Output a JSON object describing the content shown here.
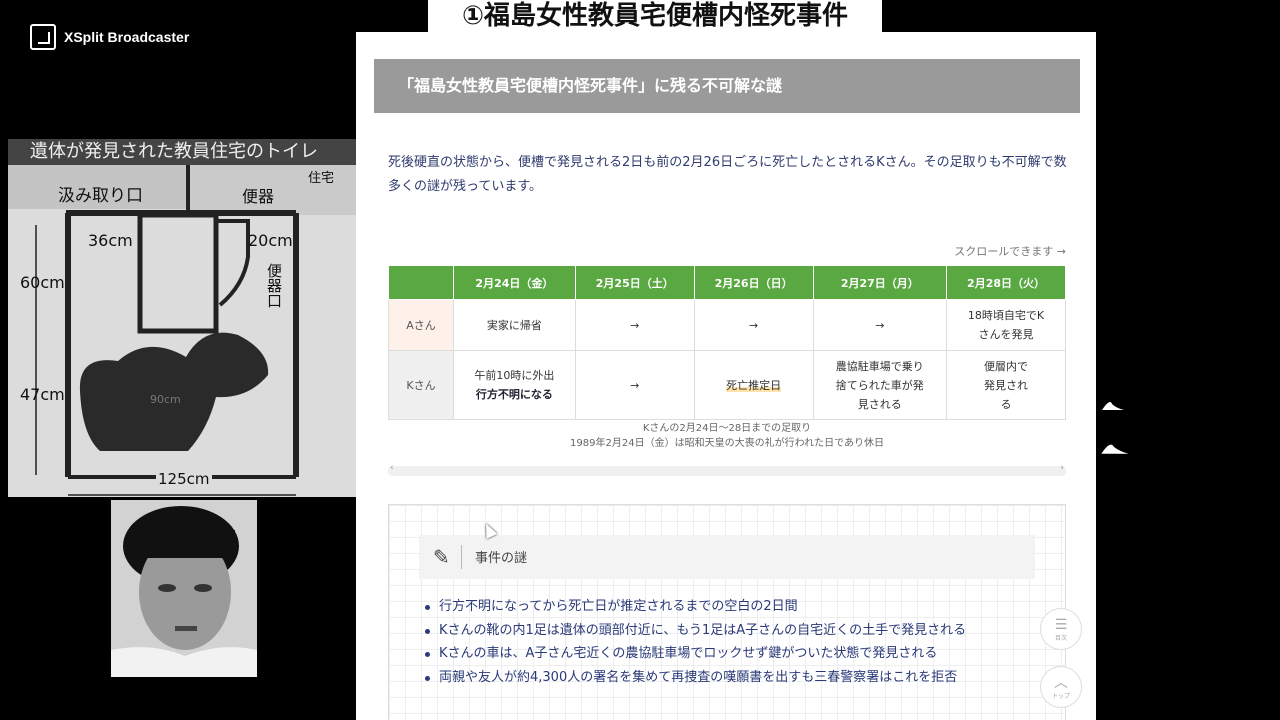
{
  "broadcast": {
    "title": "①福島女性教員宅便槽内怪死事件",
    "app_name": "XSplit Broadcaster"
  },
  "floorplan": {
    "caption": "遺体が発見された教員住宅のトイレ",
    "labels": {
      "kumitori": "汲み取り口",
      "benki": "便器",
      "jutaku": "住宅",
      "benki_vertical": "便器口",
      "w36": "36cm",
      "w20": "20cm",
      "h60": "60cm",
      "h47": "47cm",
      "h90": "90cm",
      "w125": "125cm"
    }
  },
  "page": {
    "section_title": "「福島女性教員宅便槽内怪死事件」に残る不可解な謎",
    "intro": "死後硬直の状態から、便槽で発見される2日も前の2月26日ごろに死亡したとされるKさん。その足取りも不可解で数多くの謎が残っています。",
    "scroll_hint": "スクロールできます →",
    "table": {
      "headers": [
        "",
        "2月24日（金）",
        "2月25日（土）",
        "2月26日（日）",
        "2月27日（月）",
        "2月28日（火）"
      ],
      "rows": [
        {
          "label": "Aさん",
          "cells": [
            "実家に帰省",
            "→",
            "→",
            "→",
            "18時頃自宅でKさんを発見"
          ]
        },
        {
          "label": "Kさん",
          "cells": [
            "午前10時に外出",
            "→",
            "死亡推定日",
            "農協駐車場で乗り捨てられた車が発見される",
            "便層内で発見される"
          ],
          "cell0_bold": "行方不明になる"
        }
      ]
    },
    "caption_line1": "Kさんの2月24日～28日までの足取り",
    "caption_line2": "1989年2月24日（金）は昭和天皇の大喪の礼が行われた日であり休日",
    "mystery": {
      "title": "事件の謎",
      "items": [
        "行方不明になってから死亡日が推定されるまでの空白の2日間",
        "Kさんの靴の内1足は遺体の頭部付近に、もう1足はA子さんの自宅近くの土手で発見される",
        "Kさんの車は、A子さん宅近くの農協駐車場でロックせず鍵がついた状態で発見される",
        "両親や友人が約4,300人の署名を集めて再捜査の嘆願書を出すも三春警察署はこれを拒否"
      ]
    },
    "fab": {
      "toc_label": "目次",
      "top_label": "トップ"
    },
    "colors": {
      "green": "#5aa841",
      "section_gray": "#9a9a9a",
      "text_navy": "#2a3a7a"
    }
  }
}
